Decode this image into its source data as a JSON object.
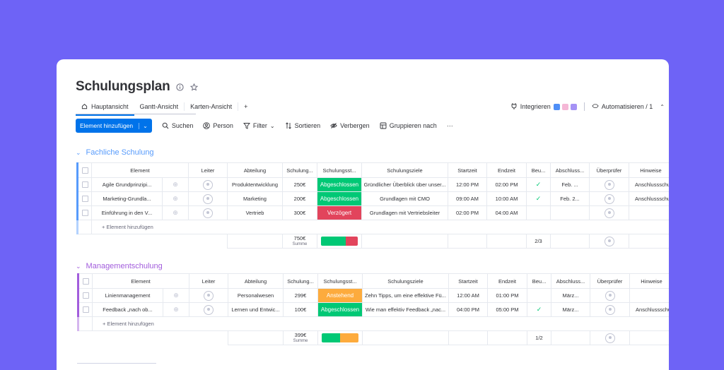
{
  "title": "Schulungsplan",
  "tabs": [
    {
      "label": "Hauptansicht"
    },
    {
      "label": "Gantt-Ansicht"
    },
    {
      "label": "Karten-Ansicht"
    },
    {
      "label": "+"
    }
  ],
  "integrate_label": "Integrieren",
  "automate_label": "Automatisieren / 1",
  "toolbar": {
    "new_item": "Element hinzufügen",
    "search": "Suchen",
    "person": "Person",
    "filter": "Filter",
    "sort": "Sortieren",
    "hide": "Verbergen",
    "group_by": "Gruppieren nach",
    "more": "···"
  },
  "columns": [
    "Element",
    "Leiter",
    "Abteilung",
    "Schulung...",
    "Schulungsst...",
    "Schulungsziele",
    "Startzeit",
    "Endzeit",
    "Beu...",
    "Abschluss...",
    "Überprüfer",
    "Hinweise"
  ],
  "groups": [
    {
      "name": "Fachliche Schulung",
      "color": "#579bfc",
      "columns": [
        "Element",
        "Leiter",
        "Abteilung",
        "Schulung...",
        "Schulungsst...",
        "Schulungsziele",
        "Startzeit",
        "Endzeit",
        "Beu...",
        "Abschluss...",
        "Überprüfer",
        "Hinweise"
      ],
      "rows": [
        {
          "name": "Agile Grundprinzipi...",
          "dept": "Produktentwicklung",
          "cost": "250€",
          "status": "Abgeschlossen",
          "status_color": "#00c875",
          "goal": "Gründlicher Überblick über unser...",
          "start": "12:00 PM",
          "end": "02:00 PM",
          "approved": "✓",
          "completion": "Feb. ...",
          "notes": "Anschlussschu"
        },
        {
          "name": "Marketing-Grundla...",
          "dept": "Marketing",
          "cost": "200€",
          "status": "Abgeschlossen",
          "status_color": "#00c875",
          "goal": "Grundlagen mit CMO",
          "start": "09:00 AM",
          "end": "10:00 AM",
          "approved": "✓",
          "completion": "Feb. 2...",
          "notes": "Anschlussschu"
        },
        {
          "name": "Einführung in den V...",
          "dept": "Vertrieb",
          "cost": "300€",
          "status": "Verzögert",
          "status_color": "#e2445c",
          "goal": "Grundlagen mit Vertriebsleiter",
          "start": "02:00 PM",
          "end": "04:00 AM",
          "approved": "",
          "completion": "",
          "notes": ""
        }
      ],
      "add_label": "+ Element hinzufügen",
      "summary": {
        "sum": "750€",
        "sum_label": "Summe",
        "approved": "2/3",
        "status_bar": [
          {
            "color": "#00c875",
            "share": 0.67
          },
          {
            "color": "#e2445c",
            "share": 0.33
          }
        ]
      }
    },
    {
      "name": "Managementschulung",
      "color": "#a25ddc",
      "columns": [
        "Element",
        "Leiter",
        "Abteilung",
        "Schulung...",
        "Schulungsst...",
        "Schulungsziele",
        "Startzeit",
        "Endzeit",
        "Beu...",
        "Abschluss...",
        "Überprüfer",
        "Hinweise"
      ],
      "rows": [
        {
          "name": "Linienmanagement",
          "dept": "Personalwesen",
          "cost": "299€",
          "status": "Anstehend",
          "status_color": "#fdab3d",
          "goal": "Zehn Tipps, um eine effektive Fü...",
          "start": "12:00 AM",
          "end": "01:00 PM",
          "approved": "",
          "completion": "März...",
          "notes": ""
        },
        {
          "name": "Feedback „nach ob...",
          "dept": "Lernen und Entwic...",
          "cost": "100€",
          "status": "Abgeschlossen",
          "status_color": "#00c875",
          "goal": "Wie man effektiv Feedback „nac...",
          "start": "04:00 PM",
          "end": "05:00 PM",
          "approved": "✓",
          "completion": "März...",
          "notes": "Anschlussschu"
        }
      ],
      "add_label": "+ Element hinzufügen",
      "summary": {
        "sum": "399€",
        "sum_label": "Summe",
        "approved": "1/2",
        "status_bar": [
          {
            "color": "#00c875",
            "share": 0.5
          },
          {
            "color": "#fdab3d",
            "share": 0.5
          }
        ]
      }
    }
  ]
}
